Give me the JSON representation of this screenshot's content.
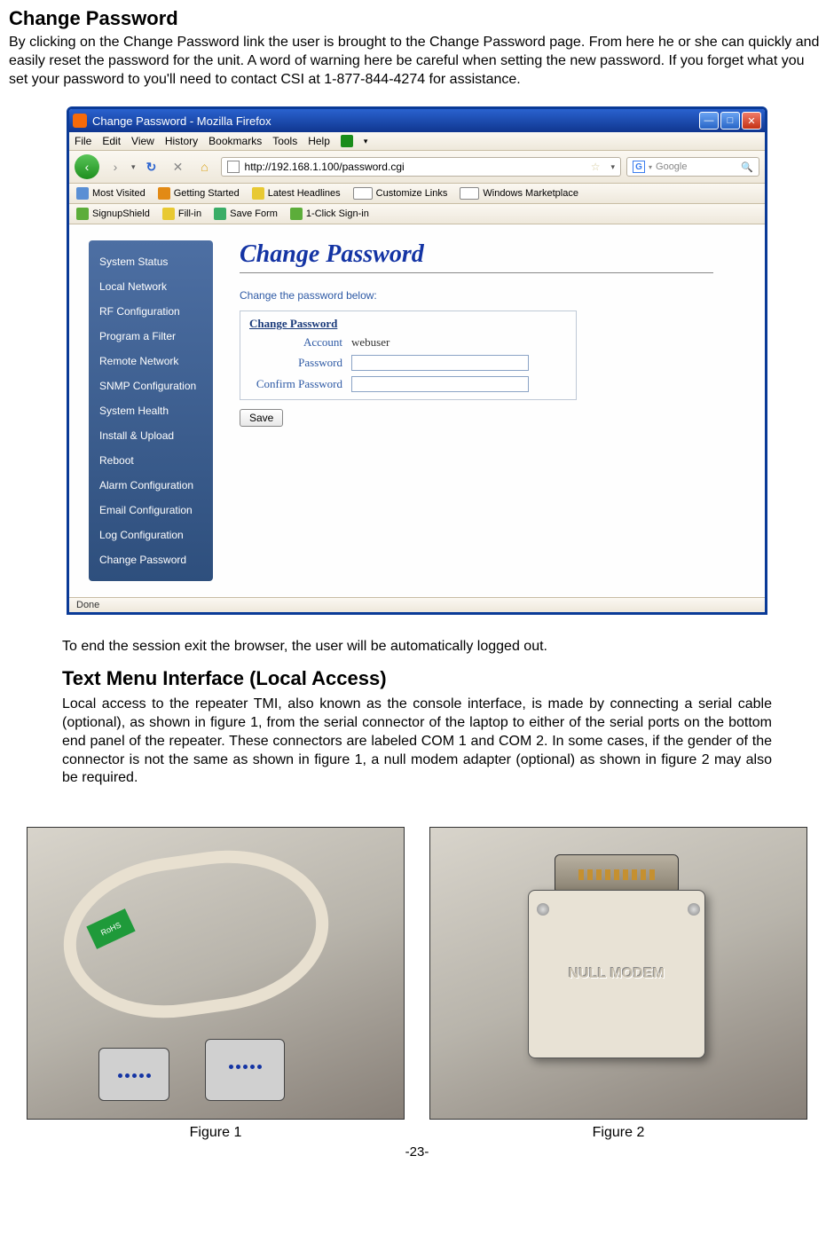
{
  "doc": {
    "heading1": "Change Password",
    "para1": "By clicking on the Change Password link the user is brought to the Change Password page.  From here he or she can quickly and easily reset the password for the unit.  A word of warning here be careful when setting the new password. If you forget what you set your password to you'll need to contact CSI at 1-877-844-4274 for assistance.",
    "para_post_screenshot": "To end the session exit  the browser, the user will be automatically logged out.",
    "heading2": "Text Menu Interface (Local Access)",
    "para2": "Local access to  the repeater TMI, also known as the console interface, is made by connecting a serial cable (optional), as shown in figure 1, from  the serial connector of the laptop to either of the serial ports on the bottom end panel of the repeater. These connectors are labeled COM 1 and COM 2. In some cases, if the gender of the connector is not the same as shown in figure 1, a null modem adapter (optional) as shown in figure 2 may also be required.",
    "figure1_caption": "Figure 1",
    "figure2_caption": "Figure 2",
    "page_number": "-23-",
    "rohs_label": "RoHS",
    "nullmodem_label": "NULL MODEM"
  },
  "browser": {
    "title": "Change Password - Mozilla Firefox",
    "menus": {
      "file": "File",
      "edit": "Edit",
      "view": "View",
      "history": "History",
      "bookmarks": "Bookmarks",
      "tools": "Tools",
      "help": "Help"
    },
    "url": "http://192.168.1.100/password.cgi",
    "search_placeholder": "Google",
    "bookmarks_bar": {
      "most_visited": "Most Visited",
      "getting_started": "Getting Started",
      "latest_headlines": "Latest Headlines",
      "customize_links": "Customize Links",
      "windows_marketplace": "Windows Marketplace"
    },
    "toolbar2": {
      "signupshield": "SignupShield",
      "fillin": "Fill-in",
      "saveform": "Save Form",
      "oneclick": "1-Click Sign-in"
    },
    "sidenav": [
      "System Status",
      "Local Network",
      "RF Configuration",
      "Program a Filter",
      "Remote Network",
      "SNMP Configuration",
      "System Health",
      "Install & Upload",
      "Reboot",
      "Alarm Configuration",
      "Email Configuration",
      "Log Configuration",
      "Change Password"
    ],
    "content": {
      "heading": "Change Password",
      "instruction": "Change the password below:",
      "form_title": "Change Password",
      "account_label": "Account",
      "account_value": "webuser",
      "password_label": "Password",
      "confirm_label": "Confirm Password",
      "save_button": "Save"
    },
    "status": "Done"
  }
}
